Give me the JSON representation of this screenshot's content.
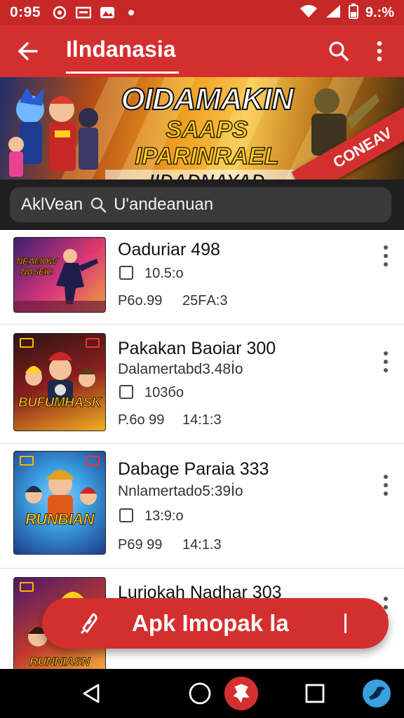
{
  "status_bar": {
    "time": "0:95",
    "battery_text": "9.:%",
    "icons": [
      "notification-icon",
      "message-icon",
      "image-icon",
      "dot-icon",
      "wifi-icon",
      "signal-icon",
      "battery-icon"
    ]
  },
  "app_bar": {
    "title": "Ilndanasia",
    "actions": [
      "search-icon",
      "more-vert-icon"
    ]
  },
  "banner": {
    "line1": "OIDAMAKIN",
    "line2": "SAAPS IPARINRAEL",
    "line3": "IIDADNAYAD GIAMIAKI",
    "ribbon": "CONEAV"
  },
  "search": {
    "prefix": "AklVean",
    "query": "U'andeanuan"
  },
  "list": [
    {
      "title": "Oaduriar 498",
      "subtitle": "",
      "check_value": "10.5:o",
      "price": "P6o.99",
      "extra": "25FА:3",
      "thumb_label": "NEAMOW NASEIC",
      "thumb_colors": [
        "#3b1e6e",
        "#d9367a",
        "#f2a03d"
      ]
    },
    {
      "title": "Pakakan Baoiar 300",
      "subtitle": "Dalamertabd3.48İo",
      "check_value": "103бo",
      "price": "P.6o 99",
      "extra": "14:1:3",
      "thumb_label": "BUFUMHASK",
      "thumb_colors": [
        "#2a1414",
        "#8a1e1e",
        "#f0b020"
      ]
    },
    {
      "title": "Dabage Paraia 333",
      "subtitle": "Nnlamertado5:39İo",
      "check_value": "13:9:o",
      "price": "P69 99",
      "extra": "14:1.3",
      "thumb_label": "RUNBIAN",
      "thumb_colors": [
        "#1e3a8a",
        "#3aa0e0",
        "#f5c842"
      ]
    },
    {
      "title": "Luriokah Nadhar 303",
      "subtitle": "",
      "check_value": "",
      "price": "",
      "extra": "",
      "thumb_label": "RUNNIASN",
      "thumb_colors": [
        "#4a1a6e",
        "#c0392b",
        "#f5b041"
      ]
    }
  ],
  "fab": {
    "label": "Apk Imoрak la",
    "icon": "edit-icon"
  },
  "nav_bar": {
    "icons": [
      "back-triangle-icon",
      "home-circle-icon",
      "app-shortcut-icon",
      "recents-square-icon",
      "bird-app-icon"
    ]
  },
  "colors": {
    "primary": "#d32f2f",
    "status_bar": "#c62828",
    "search_strip": "#1f1f1f",
    "accent_yellow": "#ffd21f"
  }
}
